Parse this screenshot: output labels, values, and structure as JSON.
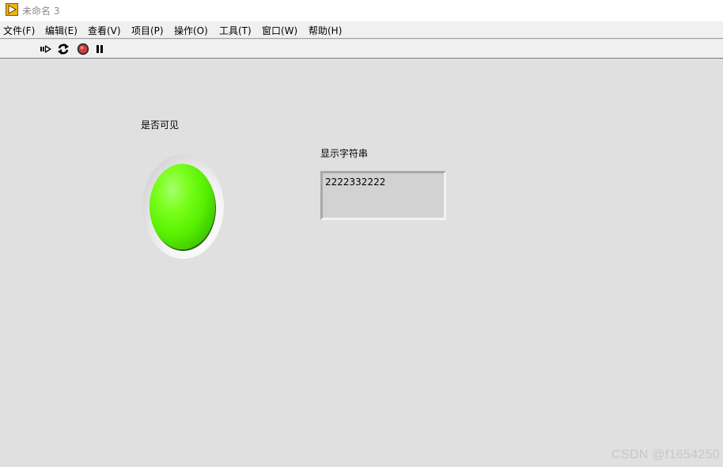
{
  "window": {
    "title": "未命名 3",
    "icon": "labview-vi-icon"
  },
  "menu": [
    {
      "label": "文件(F)"
    },
    {
      "label": "编辑(E)"
    },
    {
      "label": "查看(V)"
    },
    {
      "label": "项目(P)"
    },
    {
      "label": "操作(O)"
    },
    {
      "label": "工具(T)"
    },
    {
      "label": "窗口(W)"
    },
    {
      "label": "帮助(H)"
    }
  ],
  "toolbar": {
    "buttons": [
      {
        "icon": "run-arrow-icon"
      },
      {
        "icon": "run-continuously-icon"
      },
      {
        "icon": "abort-stop-icon"
      },
      {
        "icon": "pause-icon"
      }
    ]
  },
  "panel": {
    "led": {
      "label": "是否可见",
      "state": "on",
      "color": "#57f000"
    },
    "string_indicator": {
      "label": "显示字符串",
      "value": "2222332222"
    }
  },
  "watermark": "CSDN @f1654250"
}
